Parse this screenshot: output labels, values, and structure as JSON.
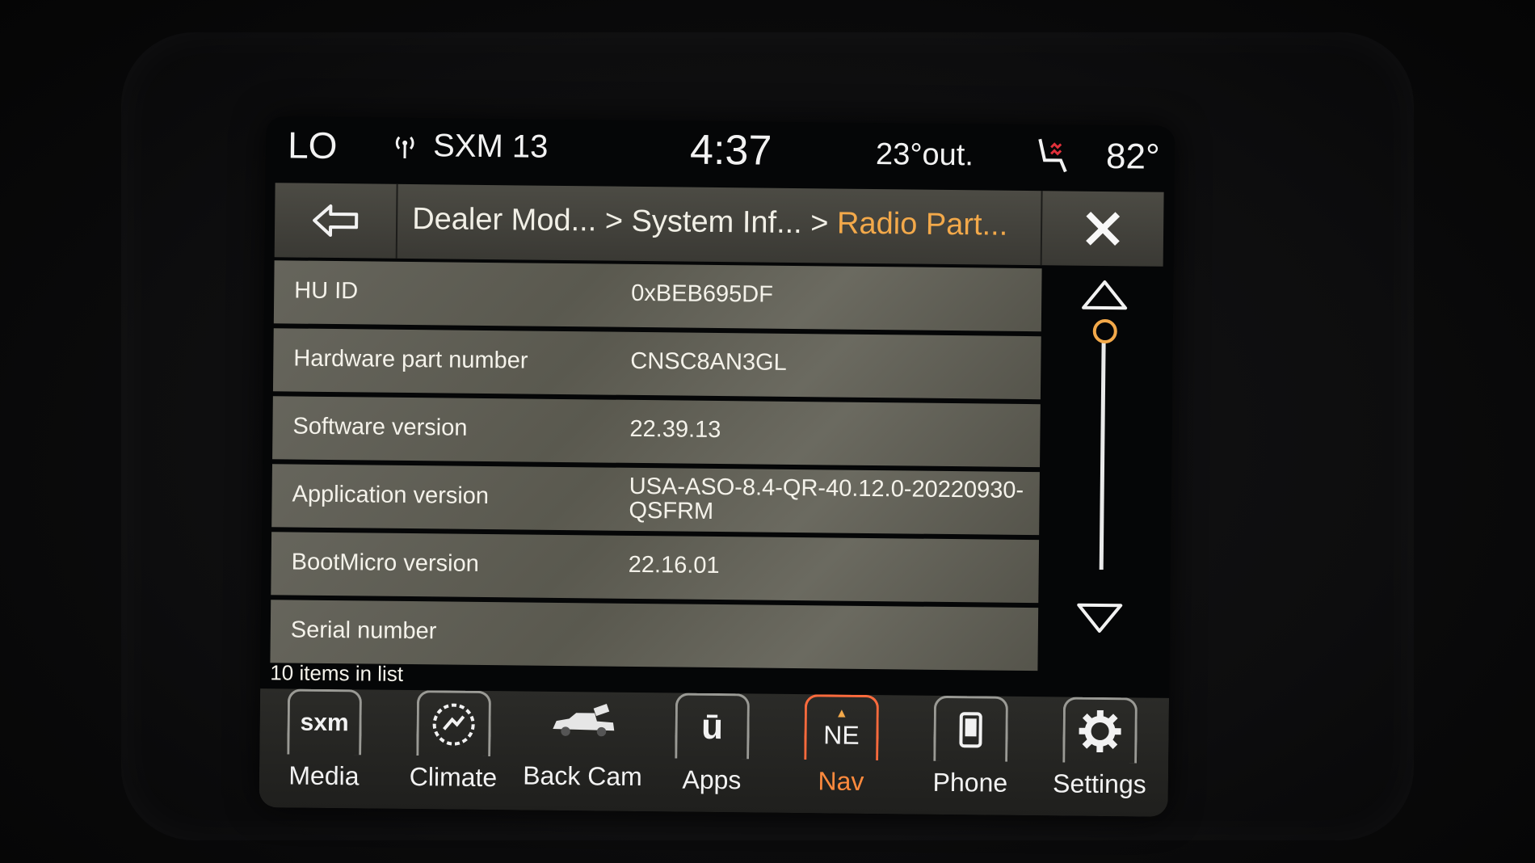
{
  "status_bar": {
    "fan": "LO",
    "source": "SXM 13",
    "time": "4:37",
    "outside_temp": "23°out.",
    "cabin_temp": "82°"
  },
  "header": {
    "breadcrumb_1": "Dealer Mod...",
    "sep1": " > ",
    "breadcrumb_2": "System Inf...",
    "sep2": " > ",
    "breadcrumb_current": "Radio Part..."
  },
  "rows": [
    {
      "label": "HU ID",
      "value": "0xBEB695DF"
    },
    {
      "label": "Hardware part number",
      "value": "CNSC8AN3GL"
    },
    {
      "label": "Software version",
      "value": "22.39.13"
    },
    {
      "label": "Application version",
      "value": "USA-ASO-8.4-QR-40.12.0-20220930-",
      "value2": "QSFRM"
    },
    {
      "label": "BootMicro version",
      "value": "22.16.01"
    },
    {
      "label": "Serial number",
      "value": ""
    }
  ],
  "list_count": "10 items in list",
  "nav": {
    "media": "Media",
    "media_logo": "sxm",
    "climate": "Climate",
    "backcam": "Back Cam",
    "apps": "Apps",
    "apps_logo": "ū",
    "nav": "Nav",
    "nav_dir": "NE",
    "phone": "Phone",
    "settings": "Settings"
  },
  "colors": {
    "accent": "#f3a94a",
    "nav_active": "#ff8a3d"
  }
}
